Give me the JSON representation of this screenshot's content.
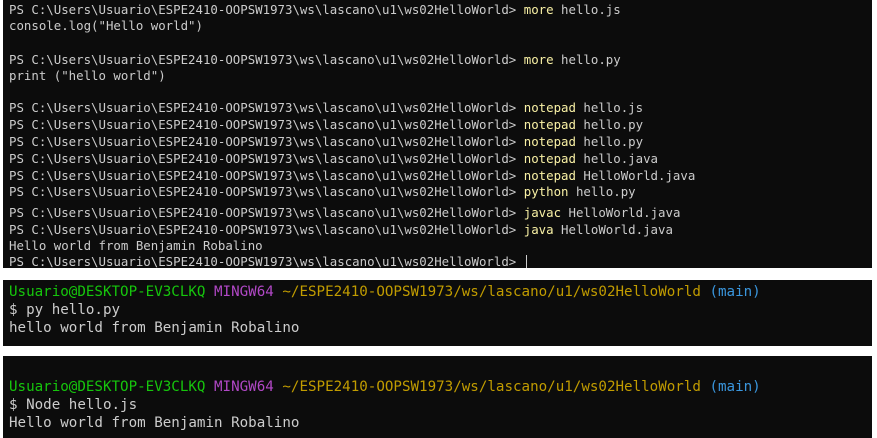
{
  "powershell": {
    "prompt": "PS C:\\Users\\Usuario\\ESPE2410-OOPSW1973\\ws\\lascano\\u1\\ws02HelloWorld> ",
    "lines": [
      {
        "prompt": true,
        "cmd": "more",
        "args": " hello.js"
      },
      {
        "prompt": false,
        "text": "console.log(\"Hello world\")"
      },
      {
        "prompt": true,
        "cmd": "more",
        "args": " hello.py"
      },
      {
        "prompt": false,
        "text": "print (\"hello world\")"
      },
      {
        "prompt": true,
        "cmd": "notepad",
        "args": " hello.js"
      },
      {
        "prompt": true,
        "cmd": "notepad",
        "args": " hello.py"
      },
      {
        "prompt": true,
        "cmd": "notepad",
        "args": " hello.py"
      },
      {
        "prompt": true,
        "cmd": "notepad",
        "args": " hello.java"
      },
      {
        "prompt": true,
        "cmd": "notepad",
        "args": " HelloWorld.java"
      },
      {
        "prompt": true,
        "cmd": "python",
        "args": " hello.py"
      },
      {
        "prompt": true,
        "cmd": "javac",
        "args": " HelloWorld.java"
      },
      {
        "prompt": true,
        "cmd": "java",
        "args": " HelloWorld.java"
      },
      {
        "prompt": false,
        "text": "Hello world from Benjamin Robalino"
      },
      {
        "prompt": true,
        "cmd": "",
        "args": "",
        "cursor": true
      }
    ]
  },
  "bash1": {
    "user": "Usuario@DESKTOP-EV3CLKQ",
    "system": "MINGW64",
    "path": "~/ESPE2410-OOPSW1973/ws/lascano/u1/ws02HelloWorld",
    "branch": "(main)",
    "command": "$ py hello.py",
    "output": "hello world from Benjamin Robalino"
  },
  "bash2": {
    "user": "Usuario@DESKTOP-EV3CLKQ",
    "system": "MINGW64",
    "path": "~/ESPE2410-OOPSW1973/ws/lascano/u1/ws02HelloWorld",
    "branch": "(main)",
    "command": "$ Node hello.js",
    "output": "Hello world from Benjamin Robalino"
  },
  "colors": {
    "background": "#0c0c0c",
    "text": "#cccccc",
    "command": "#f9f1a5",
    "user": "#16c60c",
    "system": "#b148c6",
    "path": "#c19c00",
    "branch": "#3a96dd"
  }
}
